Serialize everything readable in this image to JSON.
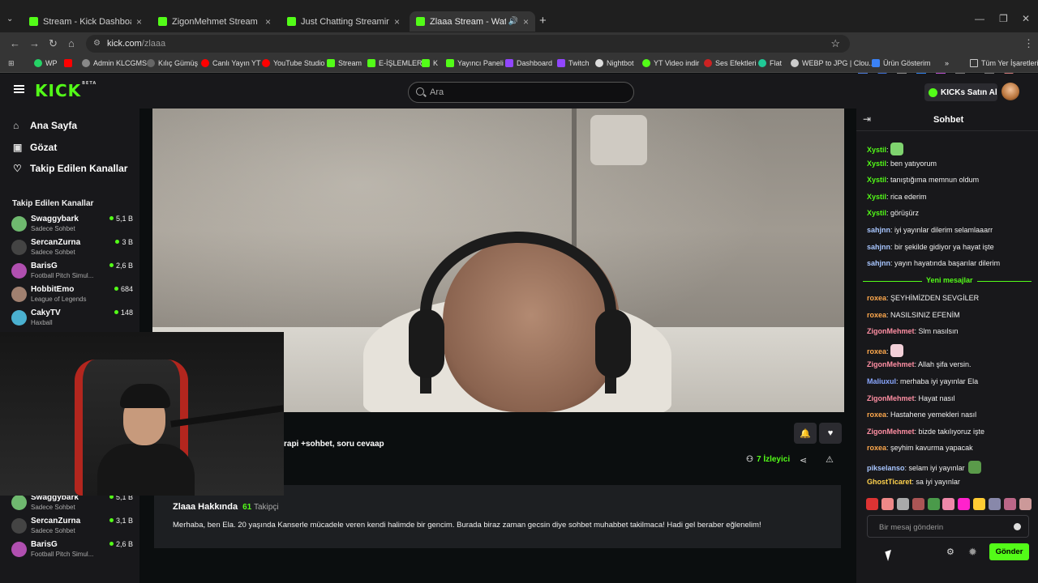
{
  "browser": {
    "tabs": [
      {
        "title": "Stream - Kick Dashboard"
      },
      {
        "title": "ZigonMehmet Stream - Watch"
      },
      {
        "title": "Just Chatting Streaming - Live S"
      },
      {
        "title": "Zlaaa Stream - Watch Live o"
      }
    ],
    "url_host": "kick.com",
    "url_path": "/zlaaa",
    "bookmarks": [
      {
        "label": "WP",
        "color": "#25d366"
      },
      {
        "label": "",
        "color": "#ff0000"
      },
      {
        "label": "Admin KLCGMS",
        "color": "#888888"
      },
      {
        "label": "Kılıç Gümüş",
        "color": "#666666"
      },
      {
        "label": "Canlı Yayın YT",
        "color": "#ff0000"
      },
      {
        "label": "YouTube Studio",
        "color": "#ff0000"
      },
      {
        "label": "Stream",
        "color": "#53fc18"
      },
      {
        "label": "E-İŞLEMLER",
        "color": "#53fc18"
      },
      {
        "label": "K",
        "color": "#53fc18"
      },
      {
        "label": "Yayıncı Paneli",
        "color": "#53fc18"
      },
      {
        "label": "Dashboard",
        "color": "#9146ff"
      },
      {
        "label": "Twitch",
        "color": "#9146ff"
      },
      {
        "label": "Nightbot",
        "color": "#dddddd"
      },
      {
        "label": "YT Video indir",
        "color": "#53fc18"
      },
      {
        "label": "Ses Efektleri",
        "color": "#cc2222"
      },
      {
        "label": "Flat",
        "color": "#20c997"
      },
      {
        "label": "WEBP to JPG | Clou...",
        "color": "#cccccc"
      },
      {
        "label": "Ürün Gösterim",
        "color": "#3b82f6"
      },
      {
        "label": "»",
        "color": ""
      },
      {
        "label": "Tüm Yer İşaretleri",
        "color": "#cccccc"
      }
    ]
  },
  "header": {
    "logo": "KICK",
    "logo_badge": "BETA",
    "search_placeholder": "Ara",
    "kicks_button": "KICKs Satın Al"
  },
  "sidebar": {
    "nav": [
      {
        "label": "Ana Sayfa",
        "icon": "home-icon"
      },
      {
        "label": "Gözat",
        "icon": "browse-icon"
      },
      {
        "label": "Takip Edilen Kanallar",
        "icon": "heart-icon"
      }
    ],
    "section_title": "Takip Edilen Kanallar",
    "channels": [
      {
        "name": "Swaggybark",
        "category": "Sadece Sohbet",
        "viewers": "5,1 B",
        "color": "#6fb96f"
      },
      {
        "name": "SercanZurna",
        "category": "Sadece Sohbet",
        "viewers": "3 B",
        "color": "#444444"
      },
      {
        "name": "BarisG",
        "category": "Football Pitch Simul...",
        "viewers": "2,6 B",
        "color": "#b04fb0"
      },
      {
        "name": "HobbitEmo",
        "category": "League of Legends",
        "viewers": "684",
        "color": "#a08070"
      },
      {
        "name": "CakyTV",
        "category": "Haxball",
        "viewers": "148",
        "color": "#4ab0d0"
      }
    ],
    "channels_lower": [
      {
        "name": "Swaggybark",
        "category": "Sadece Sohbet",
        "viewers": "5,1 B",
        "color": "#6fb96f"
      },
      {
        "name": "SercanZurna",
        "category": "Sadece Sohbet",
        "viewers": "3,1 B",
        "color": "#444444"
      },
      {
        "name": "BarisG",
        "category": "Football Pitch Simul...",
        "viewers": "2,6 B",
        "color": "#b04fb0"
      }
    ]
  },
  "stream": {
    "title_fragment": "rapi +sohbet, soru cevaap",
    "viewers_count": "7",
    "viewers_label": "İzleyici"
  },
  "about": {
    "heading": "Zlaaa Hakkında",
    "followers": "61",
    "followers_label": "Takipçi",
    "text": "Merhaba, ben Ela. 20 yaşında Kanserle mücadele veren kendi halimde bir gencim. Burada biraz zaman gecsin diye sohbet muhabbet takilmaca! Hadi gel beraber eğlenelim!"
  },
  "chat": {
    "title": "Sohbet",
    "messages": [
      {
        "user": "Xystil",
        "color": "#53fc18",
        "text": "",
        "emote": "#7fd36f"
      },
      {
        "user": "Xystil",
        "color": "#53fc18",
        "text": "ben yatıyorum",
        "emote": ""
      },
      {
        "user": "Xystil",
        "color": "#53fc18",
        "text": "tanıştığıma memnun oldum",
        "emote": ""
      },
      {
        "user": "Xystil",
        "color": "#53fc18",
        "text": "rica ederim",
        "emote": ""
      },
      {
        "user": "Xystil",
        "color": "#53fc18",
        "text": "görüşürz",
        "emote": ""
      },
      {
        "user": "sahjnn",
        "color": "#a8c6ff",
        "text": "iyi yayınlar dilerim selamlaaarr",
        "emote": ""
      },
      {
        "user": "sahjnn",
        "color": "#a8c6ff",
        "text": "bir şekilde gidiyor ya hayat işte",
        "emote": ""
      },
      {
        "user": "sahjnn",
        "color": "#a8c6ff",
        "text": "yayın hayatında başarılar dilerim",
        "emote": ""
      }
    ],
    "new_messages_label": "Yeni mesajlar",
    "messages_new": [
      {
        "user": "roxea",
        "color": "#ffa94d",
        "text": "ŞEYHİMİZDEN SEVGİLER",
        "emote": ""
      },
      {
        "user": "roxea",
        "color": "#ffa94d",
        "text": "NASILSINIZ EFENİM",
        "emote": ""
      },
      {
        "user": "ZigonMehmet",
        "color": "#ff8fa3",
        "text": "Slm nasılsın",
        "emote": ""
      },
      {
        "user": "roxea",
        "color": "#ffa94d",
        "text": "",
        "emote": "#f2d0d8"
      },
      {
        "user": "ZigonMehmet",
        "color": "#ff8fa3",
        "text": "Allah şifa versin.",
        "emote": ""
      },
      {
        "user": "Maliuxul",
        "color": "#8aa7ff",
        "text": "merhaba iyi yayınlar Ela",
        "emote": ""
      },
      {
        "user": "ZigonMehmet",
        "color": "#ff8fa3",
        "text": "Hayat nasıl",
        "emote": ""
      },
      {
        "user": "roxea",
        "color": "#ffa94d",
        "text": "Hastahene yemekleri nasıl",
        "emote": ""
      },
      {
        "user": "ZigonMehmet",
        "color": "#ff8fa3",
        "text": "bizde takılıyoruz işte",
        "emote": ""
      },
      {
        "user": "roxea",
        "color": "#ffa94d",
        "text": "şeyhim kavurma yapacak",
        "emote": ""
      },
      {
        "user": "pikselanso",
        "color": "#a8c6ff",
        "text": "selam iyi yayınlar",
        "emote": "#5a9a4a"
      },
      {
        "user": "GhostTicaret",
        "color": "#ffd24d",
        "text": "sa iyi yayınlar",
        "emote": ""
      }
    ],
    "emote_colors": [
      "#d33",
      "#e88",
      "#aaa",
      "#a55",
      "#4a9a4a",
      "#e8a",
      "#f2c",
      "#ffcc33",
      "#88a",
      "#b68",
      "#c99"
    ],
    "input_placeholder": "Bir mesaj gönderin",
    "send_label": "Gönder"
  }
}
